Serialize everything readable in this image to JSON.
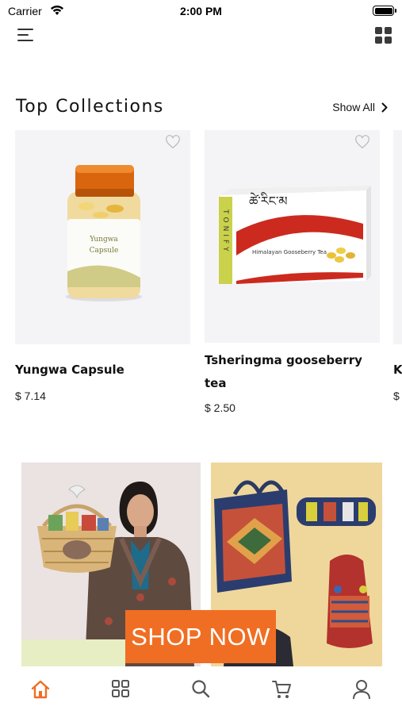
{
  "status_bar": {
    "carrier": "Carrier",
    "time": "2:00 PM",
    "battery_level": 1.0
  },
  "top_bar": {
    "menu_icon": "hamburger-menu-icon",
    "grid_icon": "grid-view-icon"
  },
  "collections": {
    "title": "Top Collections",
    "show_all_label": "Show All",
    "products": [
      {
        "name": "Yungwa Capsule",
        "price": "$ 7.14",
        "favorited": false
      },
      {
        "name": "Tsheringma gooseberry tea",
        "price": "$ 2.50",
        "favorited": false
      },
      {
        "name": "K",
        "price": "$",
        "favorited": false
      }
    ]
  },
  "product_art": {
    "capsule_label_line1": "Yungwa",
    "capsule_label_line2": "Capsule",
    "tea_side_text": "TONIFY",
    "tea_front_text": "Himalayan Gooseberry Tea"
  },
  "banners": {
    "shop_now_label": "SHOP NOW"
  },
  "tab_bar": {
    "active_tab": "home",
    "tabs": [
      "home-icon",
      "categories-icon",
      "search-icon",
      "cart-icon",
      "profile-icon"
    ]
  },
  "colors": {
    "accent": "#f06e23",
    "card_background": "#f4f4f7",
    "banner_right_background": "#efd79b"
  }
}
